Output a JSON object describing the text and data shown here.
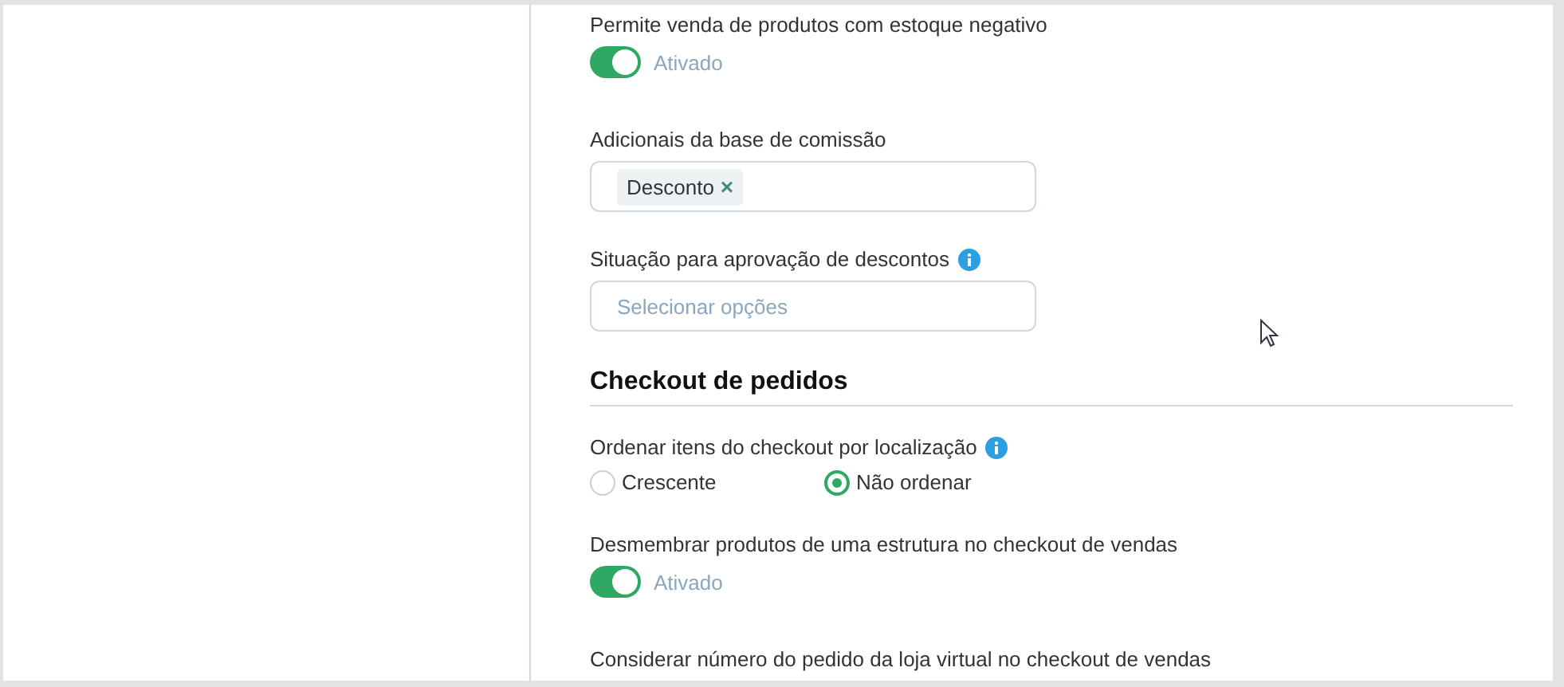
{
  "settings": [
    {
      "kind": "toggle",
      "label": "Permite venda de produtos com estoque negativo",
      "on": true,
      "state_text": "Ativado"
    },
    {
      "kind": "tags",
      "label": "Adicionais da base de comissão",
      "tags": [
        {
          "text": "Desconto",
          "remove": "×"
        }
      ]
    },
    {
      "kind": "select",
      "label": "Situação para aprovação de descontos",
      "info": true,
      "placeholder": "Selecionar opções"
    },
    {
      "kind": "heading",
      "label": "Checkout de pedidos"
    },
    {
      "kind": "radio",
      "label": "Ordenar itens do checkout por localização",
      "info": true,
      "options": [
        {
          "text": "Crescente",
          "selected": false
        },
        {
          "text": "Não ordenar",
          "selected": true
        }
      ]
    },
    {
      "kind": "toggle",
      "label": "Desmembrar produtos de uma estrutura no checkout de vendas",
      "on": true,
      "state_text": "Ativado"
    },
    {
      "kind": "label",
      "label": "Considerar número do pedido da loja virtual no checkout de vendas"
    }
  ]
}
